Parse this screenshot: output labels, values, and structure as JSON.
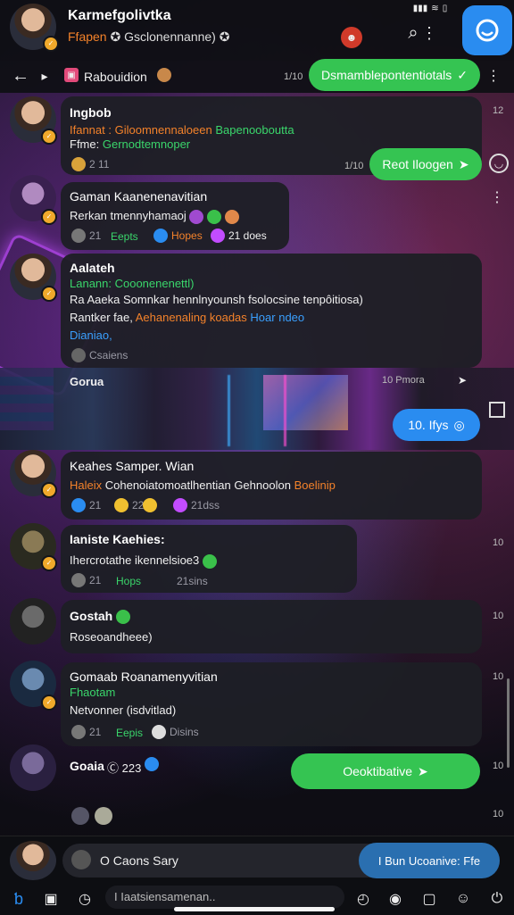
{
  "status_bar": {
    "signal": "signal-icon",
    "wifi": "wifi-icon",
    "battery": "battery-icon"
  },
  "header": {
    "title": "Karmefgolivtka",
    "subtitle_orange": "Ffapen",
    "subtitle_rest": "Gsclonennanne)",
    "fab_icon": "compose-icon"
  },
  "subbar": {
    "back": "back-arrow",
    "fwd": "forward-arrow",
    "label": "Rabouidion",
    "time": "1/10"
  },
  "messages": [
    {
      "name": "Ingbob",
      "line1": "Ifannat : Giloomnennaloeen",
      "line1b": "Bapenooboutta",
      "line2": "Ffme:",
      "line2b": "Gernodtemnoper",
      "chip": "2 11"
    },
    {
      "name": "Gaman Kaanenenavitian",
      "line1": "Rerkan tmennyhamaoj",
      "chips": [
        "21",
        "Eepts",
        "Hopes",
        "21 does"
      ]
    },
    {
      "name": "Aalateh",
      "line1": "Lanann: Cooonenenettl)",
      "line2": "Ra  Aaeka Somnkar hennlnyounsh fsolocsine tenpôitiosa)",
      "line3": "Rantker fae,",
      "line3b": "Aehanenaling koadas",
      "line3c": "Hoar ndeo",
      "line4": "Dianiao,",
      "chip": "Csaiens"
    },
    {
      "name": "Gorua",
      "time": "10 Pmora"
    },
    {
      "name": "Keahes Samper. Wian",
      "line1": "Haleix",
      "line1b": "Cohenoiatomoatlhentian",
      "line1c": "Gehnoolon",
      "line1d": "Boelinip",
      "chips": [
        "21",
        "22",
        "",
        "21dss"
      ]
    },
    {
      "name": "Ianiste Kaehies:",
      "line1": "Ihercrotathe ikennelsioe3",
      "chips": [
        "21",
        "Hops",
        "21sins"
      ]
    },
    {
      "name": "Gostah",
      "line1": "Roseoandheee)"
    },
    {
      "name": "Gomaab Roanamenyvitian",
      "line1": "Fhaotam",
      "line2": "Netvonner (isdvitlad)",
      "chips": [
        "21",
        "Eepis",
        "Disins"
      ]
    },
    {
      "name": "Goaia",
      "line1": "Ⓒ 223",
      "time": "10"
    }
  ],
  "sent": [
    {
      "text": "Dsmamblepontentiotals",
      "time": "1/10"
    },
    {
      "text": "Reot Iloogen",
      "time": "1/10"
    },
    {
      "text": "10.  Ifys",
      "time": ""
    },
    {
      "text": "Oeoktibative",
      "time": ""
    }
  ],
  "times": [
    "1/10",
    "1/10",
    "10",
    "10",
    "10",
    "10",
    "10",
    "10"
  ],
  "composer": {
    "placeholder": "O Caons Sary",
    "send_label": "I Bun Ucoanive: Ffe",
    "search": "I Iaatsiensamenan.."
  },
  "colors": {
    "green": "#35c452",
    "blue": "#2a8cf0",
    "orange": "#f4822a"
  }
}
